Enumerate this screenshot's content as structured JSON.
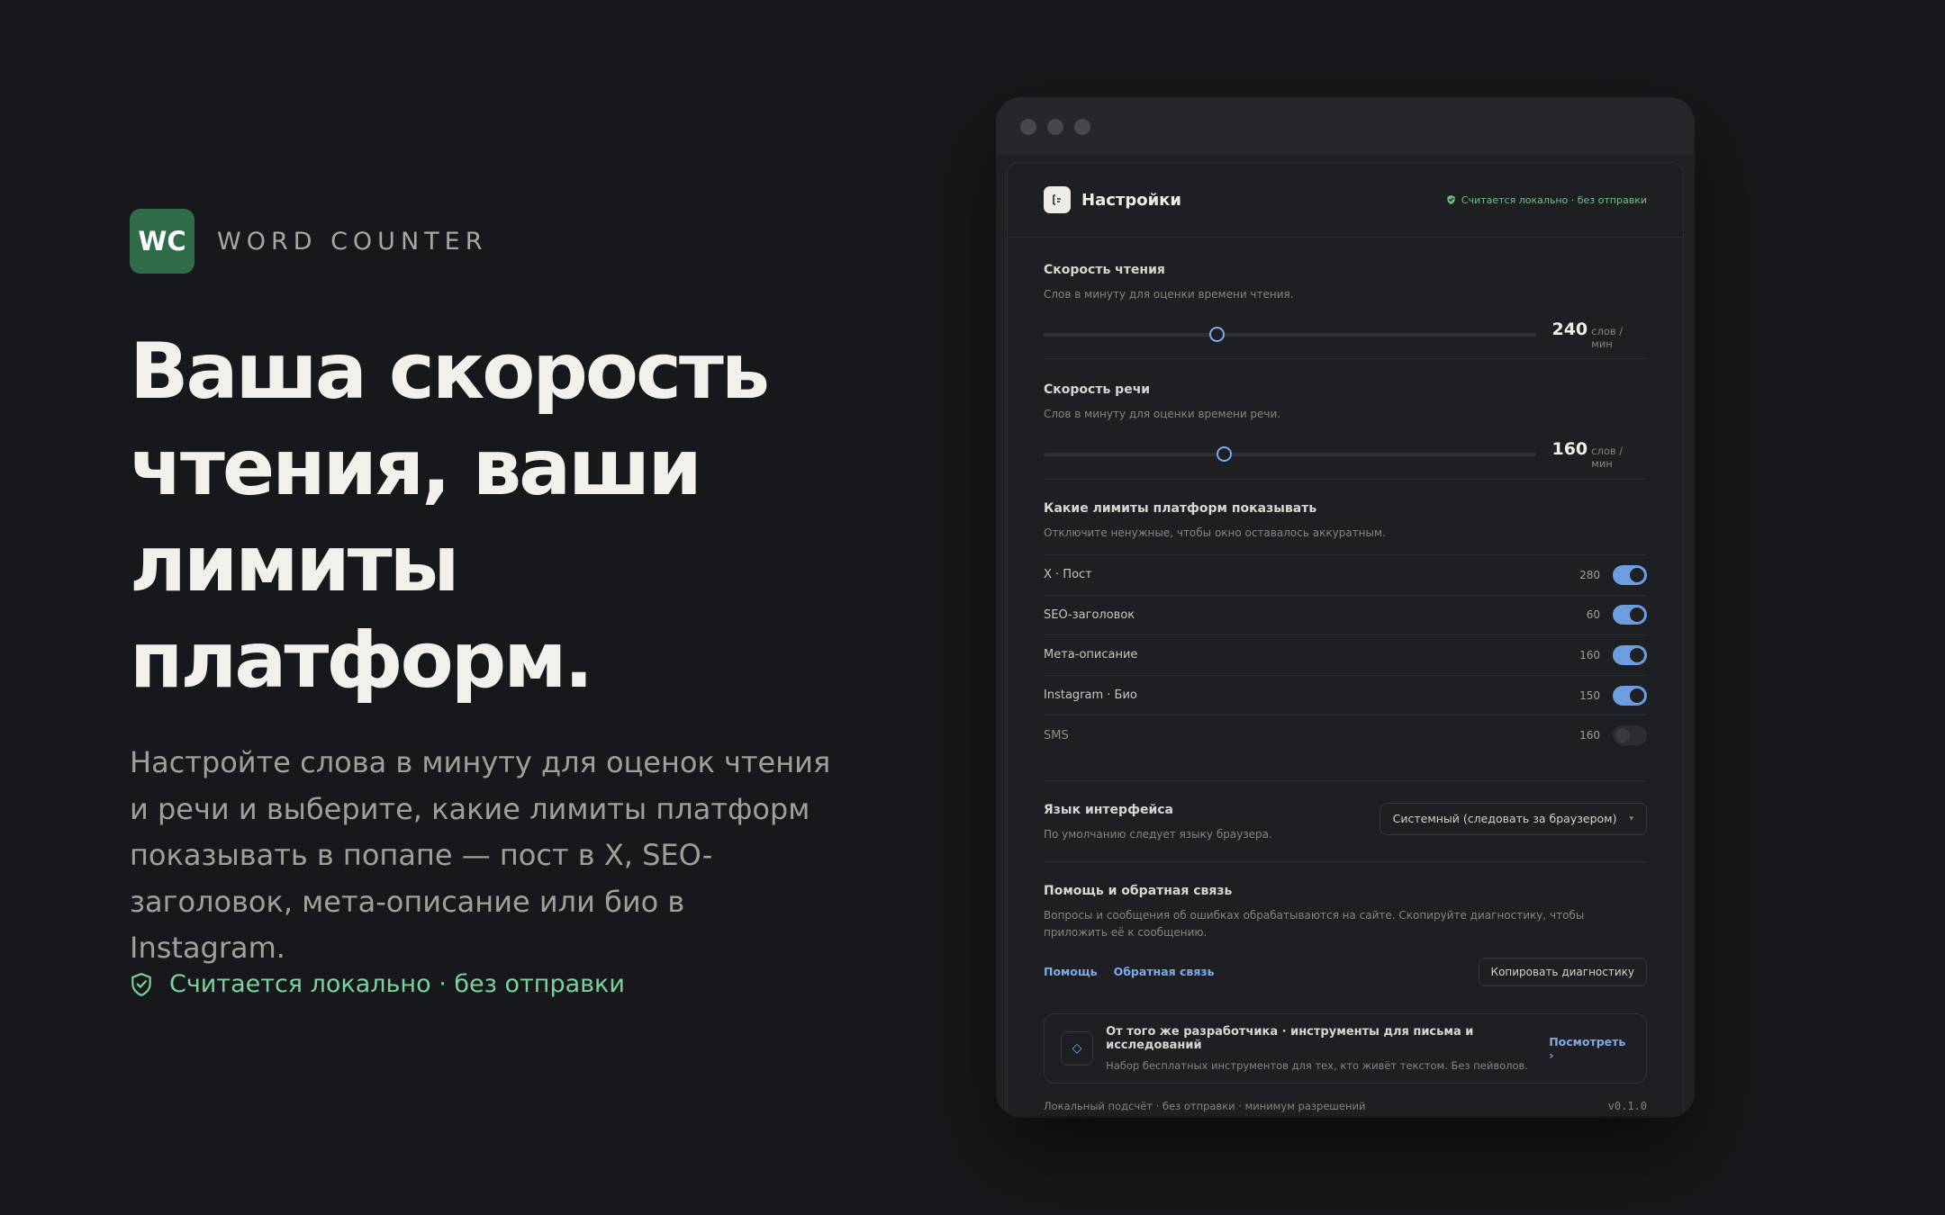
{
  "brand": {
    "logo": "WC",
    "name": "WORD COUNTER",
    "logo_color": "#2f6b47"
  },
  "hero": {
    "headline": "Ваша скорость чтения, ваши лимиты платформ.",
    "lead": "Настройте слова в минуту для оценок чтения и речи и выберите, какие лимиты платформ показывать в попапе — пост в X, SEO-заголовок, мета-описание или био в Instagram.",
    "local_note": "Считается локально · без отправки",
    "accent": "#7ad39a"
  },
  "window": {
    "header": {
      "title": "Настройки",
      "badge": "Считается локально · без отправки",
      "icon": "settings-icon"
    },
    "reading_speed": {
      "title": "Скорость чтения",
      "subtitle": "Слов в минуту для оценки времени чтения.",
      "value": "240",
      "unit": "слов / мин",
      "level": 0.35
    },
    "speech_speed": {
      "title": "Скорость речи",
      "subtitle": "Слов в минуту для оценки времени речи.",
      "value": "160",
      "unit": "слов / мин",
      "level": 0.365
    },
    "limits": {
      "title": "Какие лимиты платформ показывать",
      "subtitle": "Отключите ненужные, чтобы окно оставалось аккуратным.",
      "items": [
        {
          "name": "X · Пост",
          "count": "280",
          "enabled": true
        },
        {
          "name": "SEO-заголовок",
          "count": "60",
          "enabled": true
        },
        {
          "name": "Мета-описание",
          "count": "160",
          "enabled": true
        },
        {
          "name": "Instagram · Био",
          "count": "150",
          "enabled": true
        },
        {
          "name": "SMS",
          "count": "160",
          "enabled": false
        }
      ]
    },
    "language": {
      "title": "Язык интерфейса",
      "subtitle": "По умолчанию следует языку браузера.",
      "selected": "Системный (следовать за браузером)"
    },
    "help": {
      "title": "Помощь и обратная связь",
      "subtitle": "Вопросы и сообщения об ошибках обрабатываются на сайте. Скопируйте диагностику, чтобы приложить её к сообщению.",
      "help_link": "Помощь",
      "feedback_link": "Обратная связь",
      "copy_button": "Копировать диагностику"
    },
    "promo": {
      "title": "От того же разработчика · инструменты для письма и исследований",
      "subtitle": "Набор бесплатных инструментов для тех, кто живёт текстом. Без пейволов.",
      "link": "Посмотреть ›"
    },
    "footer": {
      "note": "Локальный подсчёт · без отправки · минимум разрешений",
      "version": "v0.1.0"
    }
  }
}
